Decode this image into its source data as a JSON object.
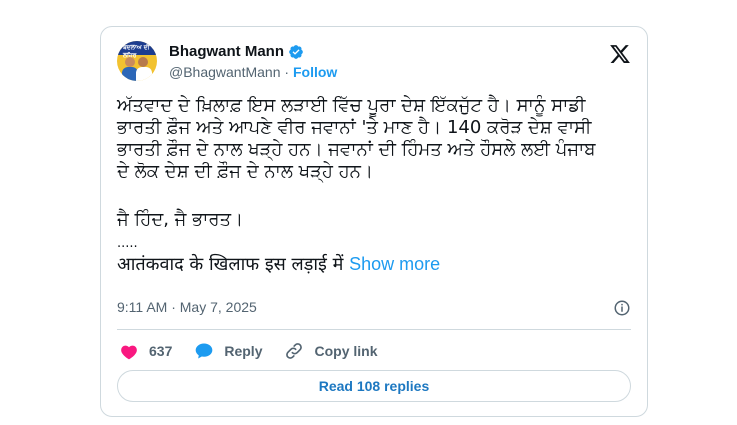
{
  "author": {
    "display_name": "Bhagwant Mann",
    "handle": "@BhagwantMann",
    "separator": "·",
    "follow_label": "Follow",
    "avatar_text": "ਬਦਲਾਅ ਦੀ ਲਹਿਰ"
  },
  "tweet": {
    "lines": [
      "ਅੱਤਵਾਦ ਦੇ ਖ਼ਿਲਾਫ਼ ਇਸ ਲੜਾਈ ਵਿੱਚ ਪੂਰਾ ਦੇਸ਼ ਇੱਕਜੁੱਟ ਹੈ। ਸਾਨੂੰ ਸਾਡੀ",
      "ਭਾਰਤੀ ਫ਼ੌਜ ਅਤੇ ਆਪਣੇ ਵੀਰ ਜਵਾਨਾਂ 'ਤੇ ਮਾਣ ਹੈ। 140 ਕਰੋੜ ਦੇਸ਼ ਵਾਸੀ",
      "ਭਾਰਤੀ ਫ਼ੌਜ ਦੇ ਨਾਲ ਖੜ੍ਹੇ ਹਨ। ਜਵਾਨਾਂ ਦੀ ਹਿੰਮਤ ਅਤੇ ਹੌਸਲੇ ਲਈ ਪੰਜਾਬ",
      "ਦੇ ਲੋਕ ਦੇਸ਼ ਦੀ ਫ਼ੌਜ ਦੇ ਨਾਲ ਖੜ੍ਹੇ ਹਨ।"
    ],
    "slogan": "ਜੈ ਹਿੰਦ, ਜੈ ਭਾਰਤ।",
    "ellipsis": ".....",
    "hindi_preview": "आतंकवाद के खिलाफ इस लड़ाई में ",
    "show_more_label": "Show more"
  },
  "meta": {
    "timestamp": "9:11 AM · May 7, 2025"
  },
  "actions": {
    "likes_count": "637",
    "reply_label": "Reply",
    "copy_link_label": "Copy link"
  },
  "replies_button_label": "Read 108 replies",
  "colors": {
    "accent": "#1d9bf0",
    "heart": "#f91880",
    "text": "#0f1419",
    "secondary": "#536471",
    "border": "#cfd9de"
  },
  "icons": [
    "verified-badge-icon",
    "x-logo-icon",
    "info-icon",
    "heart-icon",
    "reply-bubble-icon",
    "link-icon"
  ]
}
